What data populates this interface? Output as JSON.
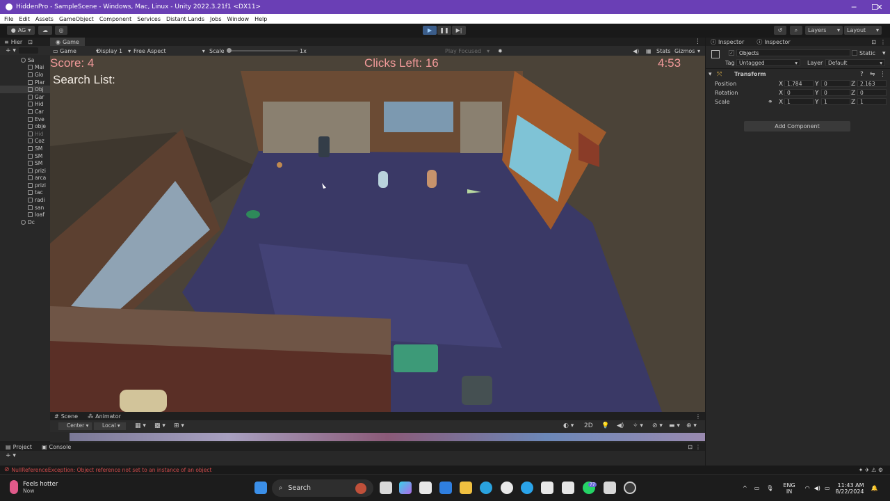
{
  "window": {
    "title": "HiddenPro - SampleScene - Windows, Mac, Linux - Unity 2022.3.21f1 <DX11>",
    "controls": [
      "─",
      "☐",
      "✕"
    ]
  },
  "menu": [
    "File",
    "Edit",
    "Assets",
    "GameObject",
    "Component",
    "Services",
    "Distant Lands",
    "Jobs",
    "Window",
    "Help"
  ],
  "toolbar": {
    "account": "AG",
    "layers_label": "Layers",
    "layout_label": "Layout"
  },
  "hierarchy": {
    "tab_label": "Hier",
    "items": [
      {
        "label": "Sa",
        "state": "scene"
      },
      {
        "label": "Mai",
        "state": "normal"
      },
      {
        "label": "Glo",
        "state": "normal"
      },
      {
        "label": "Plar",
        "state": "normal"
      },
      {
        "label": "Obj",
        "state": "selected"
      },
      {
        "label": "Gar",
        "state": "normal"
      },
      {
        "label": "Hid",
        "state": "normal"
      },
      {
        "label": "Car",
        "state": "normal"
      },
      {
        "label": "Eve",
        "state": "normal"
      },
      {
        "label": "obje",
        "state": "normal"
      },
      {
        "label": "Hid",
        "state": "dim"
      },
      {
        "label": "Coz",
        "state": "normal"
      },
      {
        "label": "SM",
        "state": "normal"
      },
      {
        "label": "SM",
        "state": "normal"
      },
      {
        "label": "SM",
        "state": "normal"
      },
      {
        "label": "prizi",
        "state": "normal"
      },
      {
        "label": "arca",
        "state": "normal"
      },
      {
        "label": "prizi",
        "state": "normal"
      },
      {
        "label": "tac",
        "state": "normal"
      },
      {
        "label": "radi",
        "state": "normal"
      },
      {
        "label": "san",
        "state": "normal"
      },
      {
        "label": "loaf",
        "state": "normal"
      },
      {
        "label": "Dc",
        "state": "scene"
      }
    ]
  },
  "game_view": {
    "tab_label": "Game",
    "mode": "Game",
    "display": "Display 1",
    "aspect": "Free Aspect",
    "scale_label": "Scale",
    "scale_value": "1x",
    "play_focused": "Play Focused",
    "stats": "Stats",
    "gizmos": "Gizmos",
    "hud": {
      "score": "Score: 4",
      "clicks_left": "Clicks Left: 16",
      "timer": "4:53",
      "search_list": "Search List:"
    }
  },
  "inspector": {
    "tabs": [
      "Inspector",
      "Inspector"
    ],
    "object_name": "Objects",
    "static_label": "Static",
    "tag_label": "Tag",
    "tag_value": "Untagged",
    "layer_label": "Layer",
    "layer_value": "Default",
    "component": "Transform",
    "position": {
      "label": "Position",
      "x": "1.784",
      "y": "0",
      "z": "2.163"
    },
    "rotation": {
      "label": "Rotation",
      "x": "0",
      "y": "0",
      "z": "0"
    },
    "scale": {
      "label": "Scale",
      "x": "1",
      "y": "1",
      "z": "1"
    },
    "add_component": "Add Component"
  },
  "scene_panel": {
    "tabs": [
      "Scene",
      "Animator"
    ],
    "pivot": "Center",
    "space": "Local",
    "mode_2d": "2D"
  },
  "bottom_panel": {
    "tabs": [
      "Project",
      "Console"
    ]
  },
  "status": {
    "error": "NullReferenceException: Object reference not set to an instance of an object"
  },
  "taskbar": {
    "weather_title": "Feels hotter",
    "weather_sub": "Now",
    "search_placeholder": "Search",
    "language_top": "ENG",
    "language_bottom": "IN",
    "time": "11:43 AM",
    "date": "8/22/2024",
    "whatsapp_badge": "77"
  },
  "colors": {
    "title_bar": "#6a3fb5",
    "hud_text": "#f29a9a",
    "floor": "#3b3a6b",
    "error_text": "#d24b4b"
  }
}
